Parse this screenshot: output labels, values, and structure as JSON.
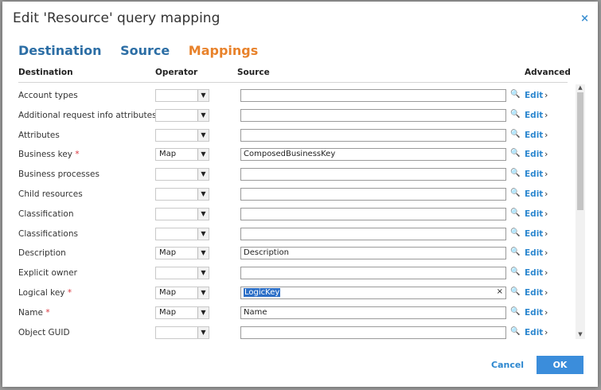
{
  "dialog": {
    "title": "Edit 'Resource' query mapping",
    "close": "×"
  },
  "tabs": [
    {
      "label": "Destination",
      "active": false
    },
    {
      "label": "Source",
      "active": false
    },
    {
      "label": "Mappings",
      "active": true
    }
  ],
  "columns": {
    "destination": "Destination",
    "operator": "Operator",
    "source": "Source",
    "advanced": "Advanced"
  },
  "rows": [
    {
      "destination": "Account types",
      "required": false,
      "operator": "",
      "source": ""
    },
    {
      "destination": "Additional request info attributes",
      "required": false,
      "operator": "",
      "source": ""
    },
    {
      "destination": "Attributes",
      "required": false,
      "operator": "",
      "source": ""
    },
    {
      "destination": "Business key",
      "required": true,
      "operator": "Map",
      "source": "ComposedBusinessKey"
    },
    {
      "destination": "Business processes",
      "required": false,
      "operator": "",
      "source": ""
    },
    {
      "destination": "Child resources",
      "required": false,
      "operator": "",
      "source": ""
    },
    {
      "destination": "Classification",
      "required": false,
      "operator": "",
      "source": ""
    },
    {
      "destination": "Classifications",
      "required": false,
      "operator": "",
      "source": ""
    },
    {
      "destination": "Description",
      "required": false,
      "operator": "Map",
      "source": "Description"
    },
    {
      "destination": "Explicit owner",
      "required": false,
      "operator": "",
      "source": ""
    },
    {
      "destination": "Logical key",
      "required": true,
      "operator": "Map",
      "source": "LogicKey",
      "selected": true
    },
    {
      "destination": "Name",
      "required": true,
      "operator": "Map",
      "source": "Name"
    },
    {
      "destination": "Object GUID",
      "required": false,
      "operator": "",
      "source": ""
    }
  ],
  "row_action": {
    "edit_label": "Edit",
    "chevron": "›",
    "search_glyph": "🔍",
    "required_mark": "*",
    "dropdown_glyph": "▼",
    "clear_glyph": "×"
  },
  "footer": {
    "cancel_label": "Cancel",
    "ok_label": "OK"
  },
  "colors": {
    "accent": "#3b8ddb",
    "active_tab": "#e8822b",
    "tab": "#2c6ea5",
    "required": "#d9363e"
  }
}
